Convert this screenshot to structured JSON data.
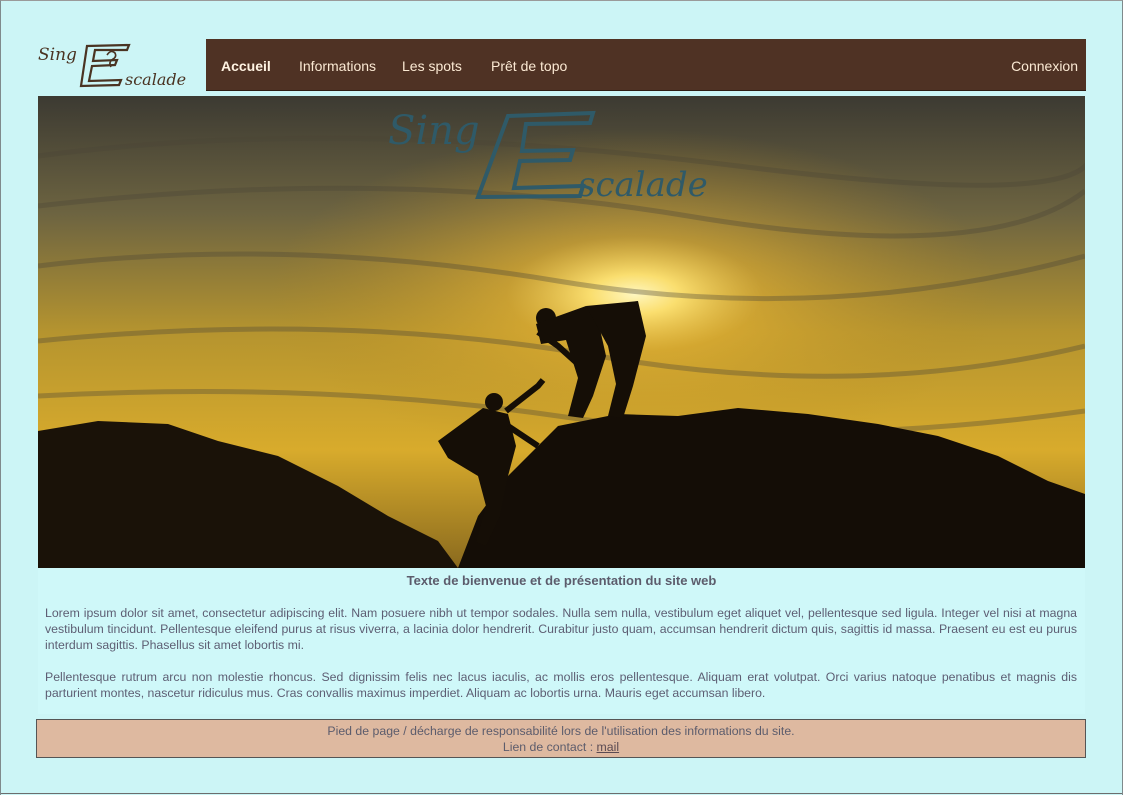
{
  "brand": {
    "logo_alt": "Sing Escalade"
  },
  "nav": {
    "items": [
      {
        "label": "Accueil",
        "active": true
      },
      {
        "label": "Informations"
      },
      {
        "label": "Les spots"
      },
      {
        "label": "Prêt de topo"
      }
    ],
    "login_label": "Connexion"
  },
  "main": {
    "intro_title": "Texte de bienvenue et de présentation du site web",
    "paragraphs": [
      "Lorem ipsum dolor sit amet, consectetur adipiscing elit. Nam posuere nibh ut tempor sodales. Nulla sem nulla, vestibulum eget aliquet vel, pellentesque sed ligula. Integer vel nisi at magna vestibulum tincidunt. Pellentesque eleifend purus at risus viverra, a lacinia dolor hendrerit. Curabitur justo quam, accumsan hendrerit dictum quis, sagittis id massa. Praesent eu est eu purus interdum sagittis. Phasellus sit amet lobortis mi.",
      "Pellentesque rutrum arcu non molestie rhoncus. Sed dignissim felis nec lacus iaculis, ac mollis eros pellentesque. Aliquam erat volutpat. Orci varius natoque penatibus et magnis dis parturient montes, nascetur ridiculus mus. Cras convallis maximus imperdiet. Aliquam ac lobortis urna. Mauris eget accumsan libero."
    ]
  },
  "footer": {
    "line1": "Pied de page / décharge de responsabilité lors de l'utilisation des informations du site.",
    "contact_prefix": "Lien de contact : ",
    "contact_link": "mail"
  },
  "colors": {
    "page_bg": "#ccf5f6",
    "nav_bg": "#4f3224",
    "footer_bg": "#deb9a0",
    "logo_brown": "#4a3322",
    "hero_logo_teal": "#2f5a68"
  }
}
